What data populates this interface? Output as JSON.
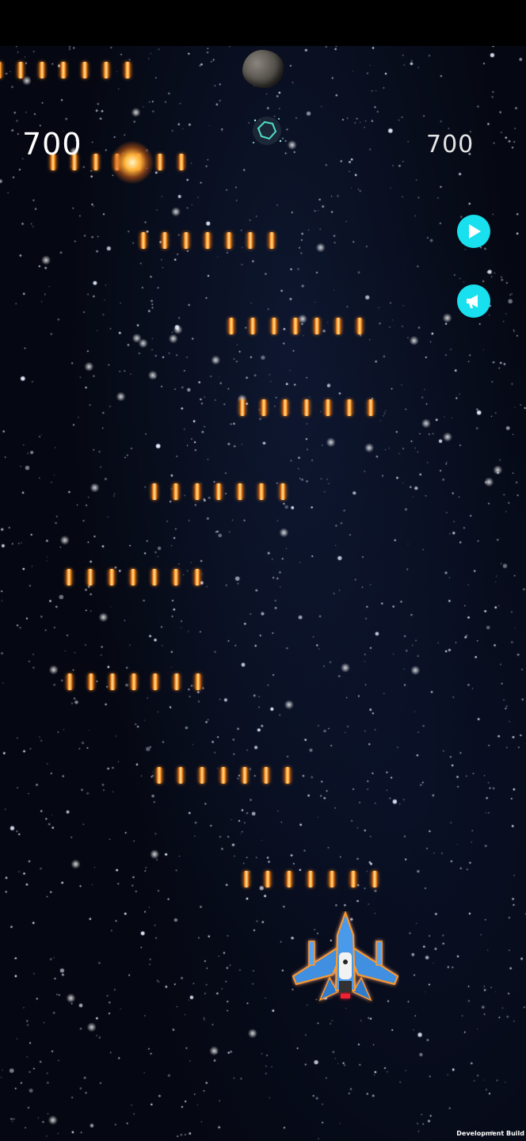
{
  "hud": {
    "score_left": "700",
    "score_right": "700",
    "play_icon": "play-icon",
    "sound_icon": "megaphone-icon"
  },
  "footer": {
    "build_label": "Development Build"
  },
  "colors": {
    "background": "#050812",
    "button": "#19e0ee",
    "bullet": "#ff9a2a",
    "ship": "#3f8fe0"
  },
  "objects": {
    "asteroid": "asteroid",
    "explosion": "explosion",
    "debris": "debris",
    "player_ship": "player-ship"
  }
}
